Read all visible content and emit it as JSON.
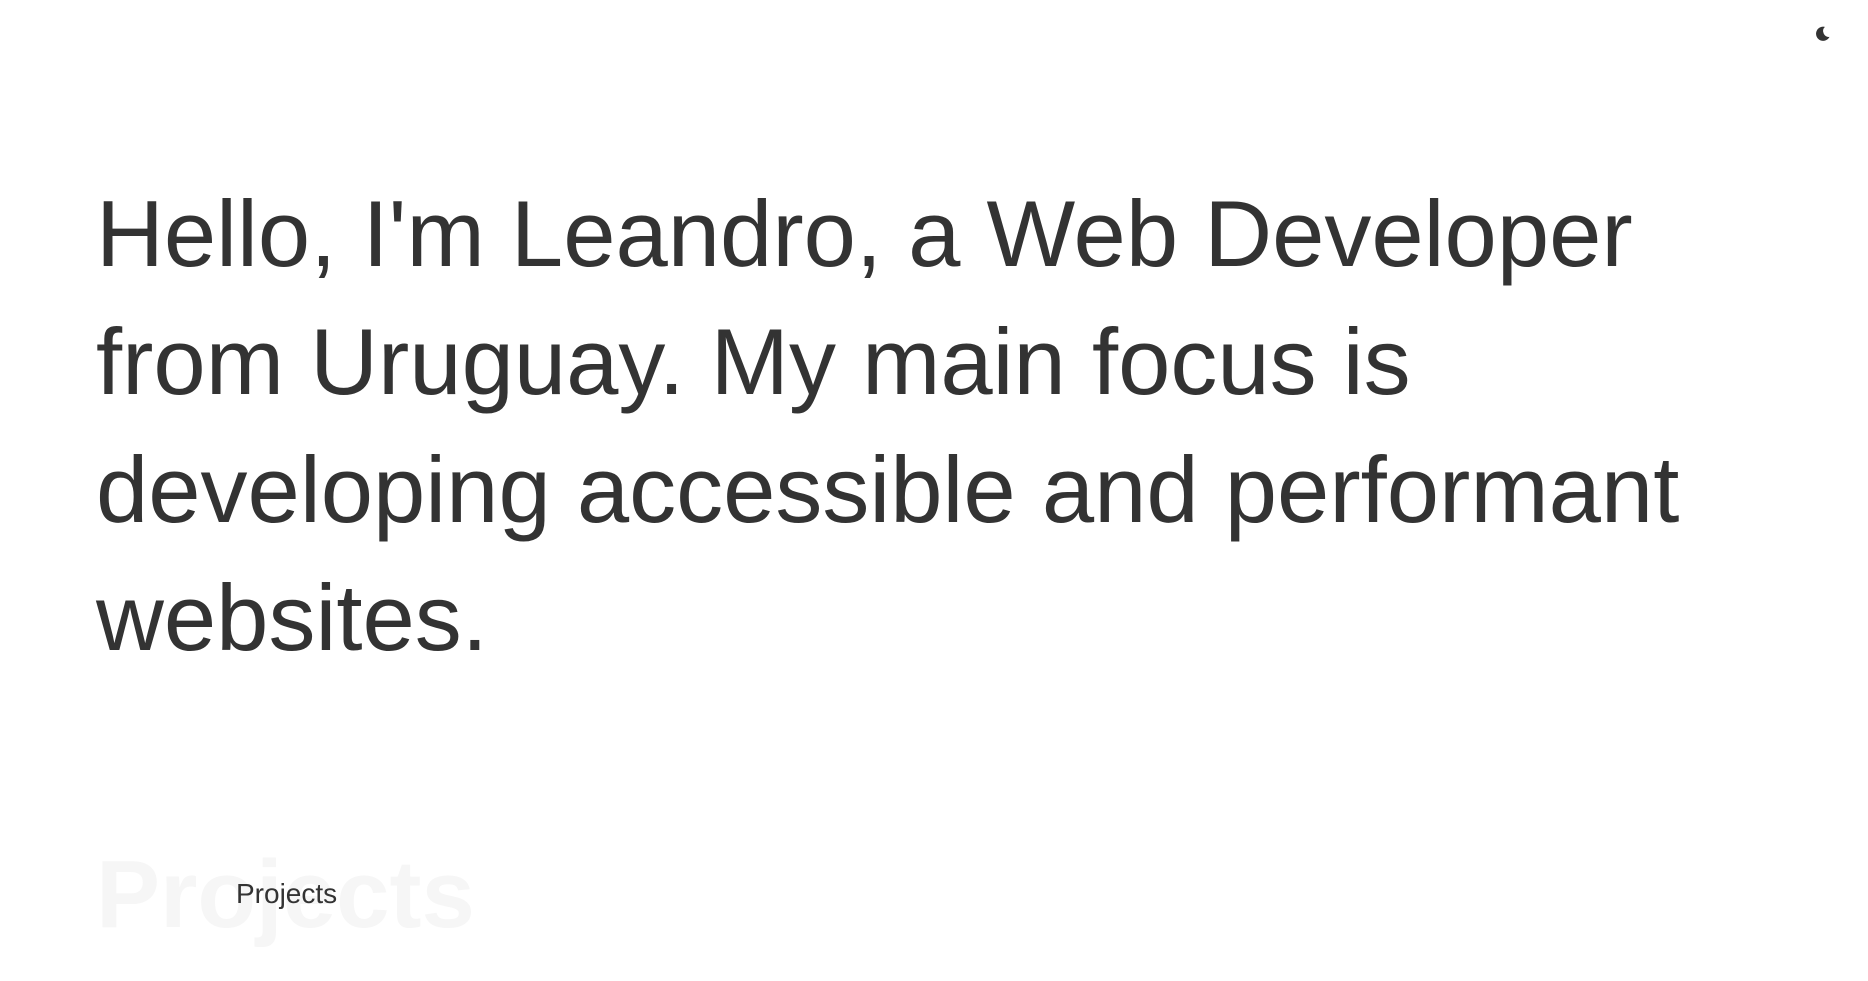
{
  "header": {
    "theme_toggle_icon": "moon-icon"
  },
  "hero": {
    "intro": "Hello, I'm Leandro, a Web Developer from Uruguay. My main focus is developing accessible and performant websites."
  },
  "projects": {
    "background_title": "Projects",
    "title": "Projects"
  },
  "colors": {
    "text": "#333333",
    "background": "#ffffff",
    "ghost_text": "#f6f6f6"
  }
}
